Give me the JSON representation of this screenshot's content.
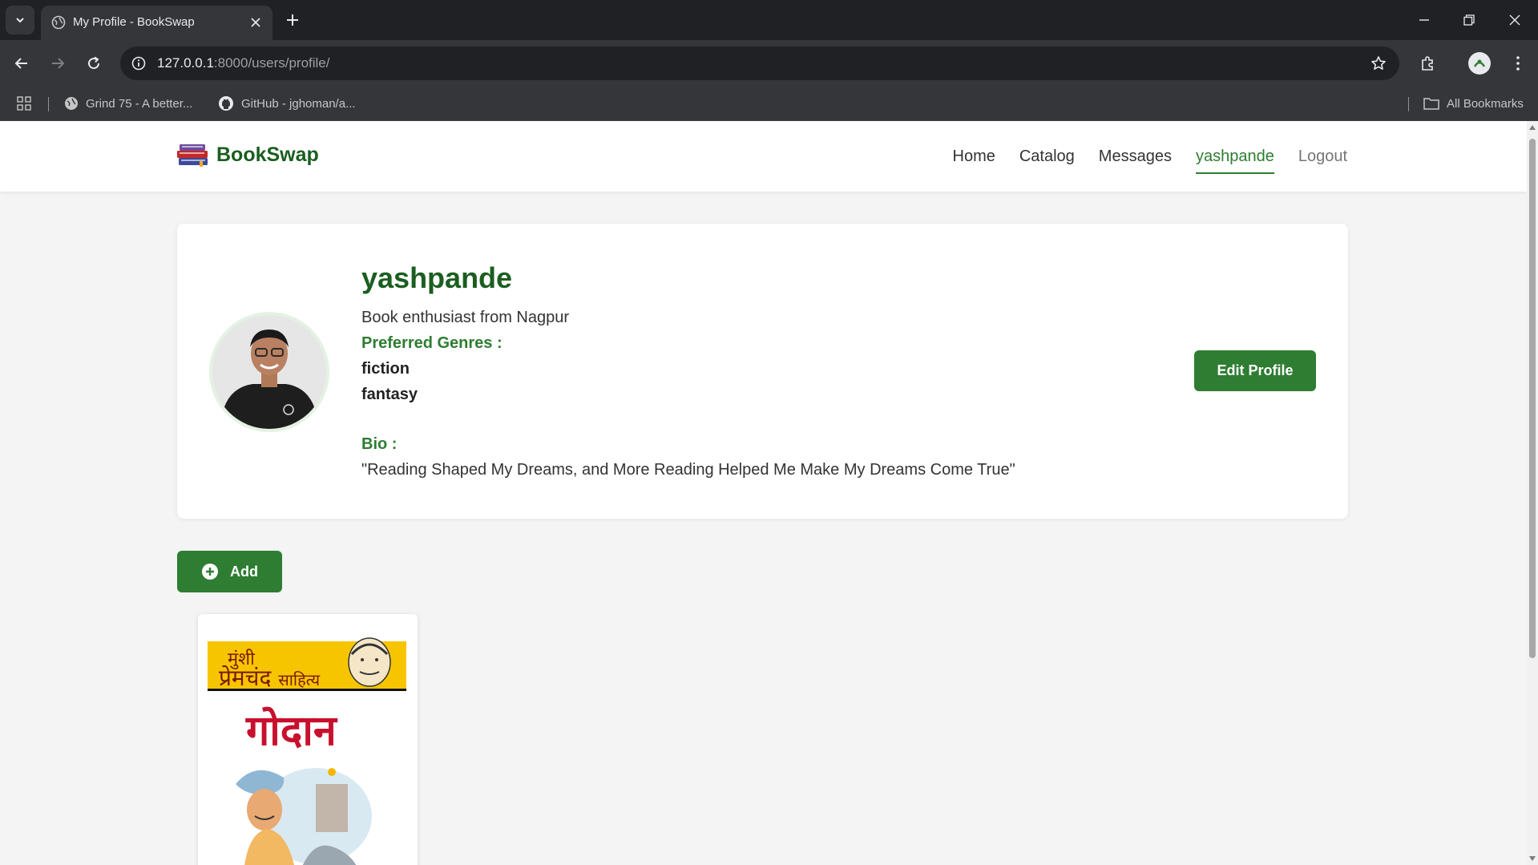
{
  "browser": {
    "tab_title": "My Profile - BookSwap",
    "url_host": "127.0.0.1",
    "url_path": ":8000/users/profile/",
    "bookmarks": [
      "Grind 75 - A better...",
      "GitHub - jghoman/a..."
    ],
    "all_bookmarks_label": "All Bookmarks"
  },
  "site": {
    "brand": "BookSwap",
    "nav": [
      "Home",
      "Catalog",
      "Messages",
      "yashpande",
      "Logout"
    ]
  },
  "profile": {
    "username": "yashpande",
    "location": "Book enthusiast from Nagpur",
    "genres_label": "Preferred Genres :",
    "genres": [
      "fiction",
      "fantasy"
    ],
    "bio_label": "Bio :",
    "bio": "\"Reading Shaped My Dreams, and More Reading Helped Me Make My Dreams Come True\"",
    "edit_button": "Edit Profile"
  },
  "actions": {
    "add_button": "Add"
  },
  "books": [
    {
      "cover_series_line1": "मुंशी",
      "cover_series_line2": "प्रेमचंद",
      "cover_series_line2b": "साहित्य",
      "cover_title": "गोदान"
    }
  ],
  "colors": {
    "brand_green": "#1b5e20",
    "accent_green": "#2e7d32",
    "chrome_dark": "#202124",
    "chrome_mid": "#35363a"
  }
}
